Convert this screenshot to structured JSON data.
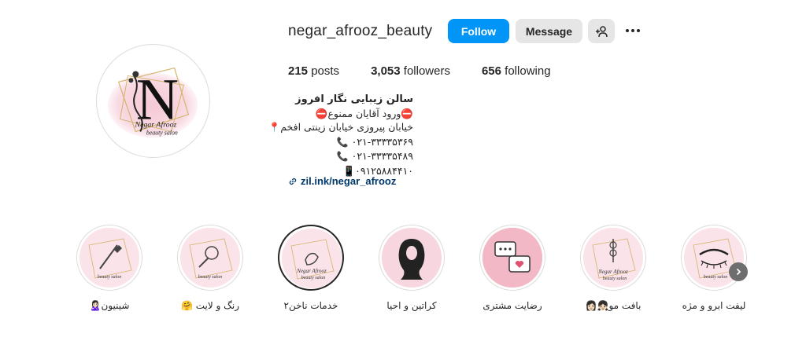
{
  "profile": {
    "username": "negar_afrooz_beauty",
    "follow_label": "Follow",
    "message_label": "Message",
    "avatar_logo_text": "Negar Afrooz beauty salon",
    "stats": {
      "posts_count": "215",
      "posts_label": "posts",
      "followers_count": "3,053",
      "followers_label": "followers",
      "following_count": "656",
      "following_label": "following"
    },
    "bio": {
      "name": "سالن زیبایی نگار افروز",
      "line1": "⛔ورود آقایان ممنوع⛔",
      "line2": "خیابان پیروزی خیابان زینتی افخم",
      "line3": "۰۲۱-۳۳۳۳۵۳۶۹",
      "line4": "۰۲۱-۳۳۳۳۵۴۸۹",
      "line5": "۰۹۱۲۵۸۸۴۴۱۰"
    },
    "link_text": "zil.ink/negar_afrooz"
  },
  "highlights": [
    {
      "label": "شینیون🙎🏻‍♀️",
      "icon": "bride-icon"
    },
    {
      "label": "رنگ و لایت 🤗",
      "icon": "hair-color-icon"
    },
    {
      "label": "خدمات ناخن۲",
      "icon": "nail-polish-icon"
    },
    {
      "label": "کراتین و احیا",
      "icon": "hair-silhouette-icon"
    },
    {
      "label": "رضایت مشتری",
      "icon": "chat-bubbles-icon"
    },
    {
      "label": "بافت مو👧🏻👩🏻",
      "icon": "braid-icon"
    },
    {
      "label": "لیفت ابرو و مژه",
      "icon": "eyelash-icon"
    }
  ],
  "colors": {
    "follow_blue": "#0095f6",
    "link_blue": "#00376b",
    "button_gray": "#e6e6e6",
    "logo_pink": "#f4c6d3",
    "logo_gold": "#d4b46a"
  }
}
